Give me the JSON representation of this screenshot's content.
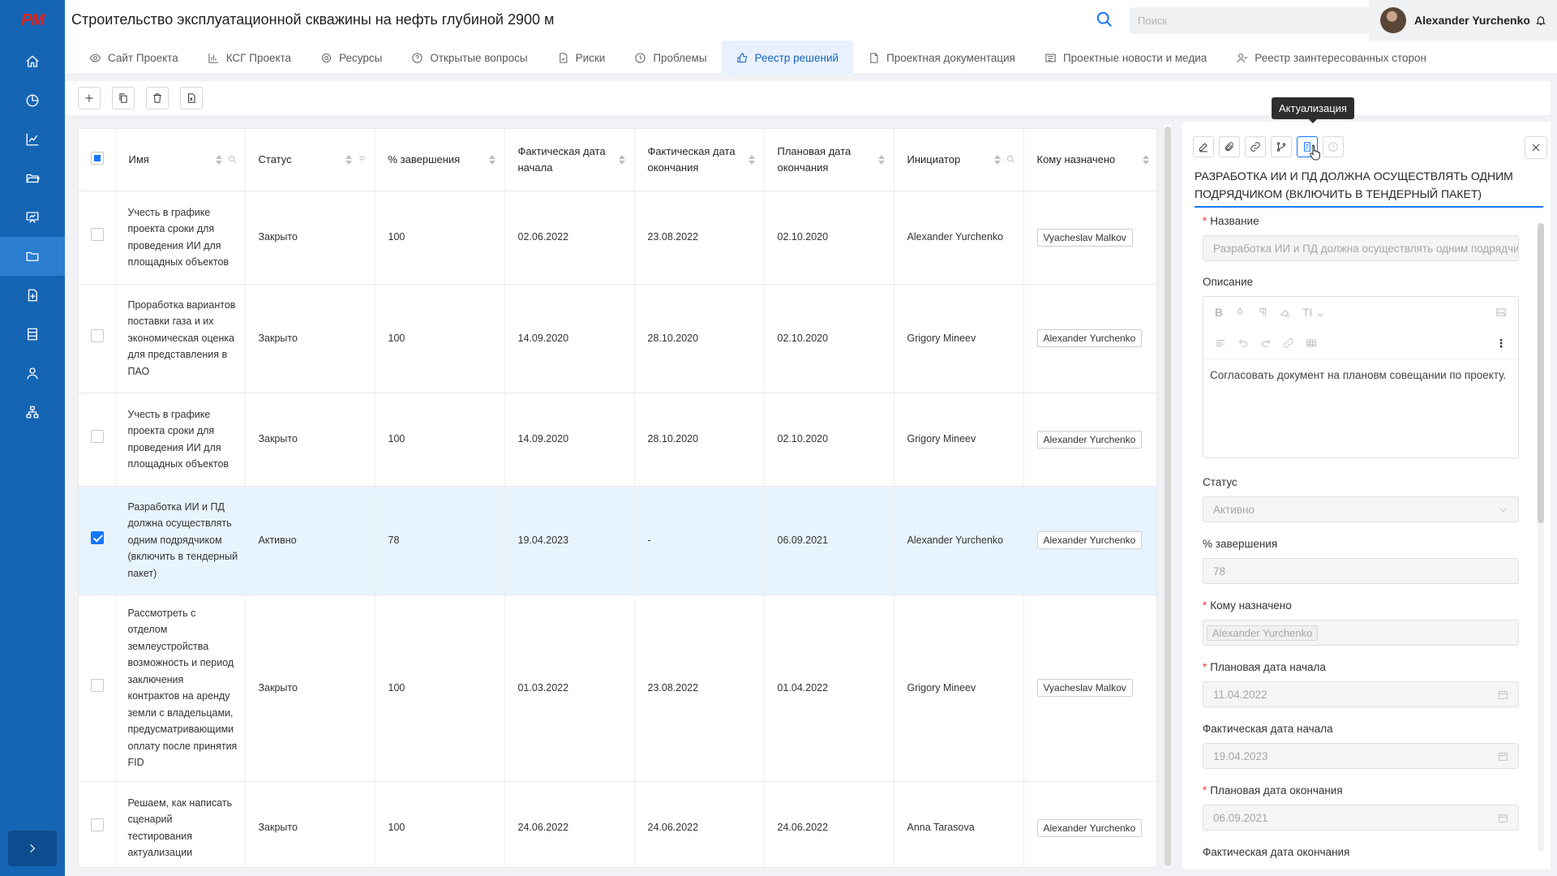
{
  "app": {
    "logo": "PM",
    "title": "Строительство эксплуатационной скважины на нефть глубиной 2900 м"
  },
  "header": {
    "search_placeholder": "Поиск",
    "user_name": "Alexander Yurchenko"
  },
  "sidebar": {
    "items": [
      {
        "icon": "home-icon"
      },
      {
        "icon": "pie-chart-icon"
      },
      {
        "icon": "line-chart-icon"
      },
      {
        "icon": "folder-open-icon"
      },
      {
        "icon": "presentation-icon"
      },
      {
        "icon": "folder-icon",
        "active": true
      },
      {
        "icon": "file-add-icon"
      },
      {
        "icon": "database-icon"
      },
      {
        "icon": "user-icon"
      },
      {
        "icon": "org-chart-icon"
      }
    ]
  },
  "tabs": [
    {
      "label": "Сайт Проекта",
      "icon": "eye-icon"
    },
    {
      "label": "КСГ Проекта",
      "icon": "bar-chart-icon"
    },
    {
      "label": "Ресурсы",
      "icon": "gear-icon"
    },
    {
      "label": "Открытые вопросы",
      "icon": "question-icon"
    },
    {
      "label": "Риски",
      "icon": "file-check-icon"
    },
    {
      "label": "Проблемы",
      "icon": "clock-icon"
    },
    {
      "label": "Реестр решений",
      "icon": "thumbs-up-icon",
      "active": true
    },
    {
      "label": "Проектная документация",
      "icon": "file-icon"
    },
    {
      "label": "Проектные новости и медиа",
      "icon": "news-icon"
    },
    {
      "label": "Реестр заинтересованных сторон",
      "icon": "users-icon"
    }
  ],
  "table": {
    "columns": [
      "Имя",
      "Статус",
      "% завершения",
      "Фактическая дата начала",
      "Фактическая дата окончания",
      "Плановая дата окончания",
      "Инициатор",
      "Кому назначено"
    ],
    "rows": [
      {
        "name": "Учесть в графике проекта сроки для проведения ИИ для площадных объектов",
        "status": "Закрыто",
        "pct": "100",
        "fact_start": "02.06.2022",
        "fact_end": "23.08.2022",
        "plan_end": "02.10.2020",
        "initiator": "Alexander Yurchenko",
        "assignee": "Vyacheslav Malkov"
      },
      {
        "name": "Проработка вариантов поставки газа и их экономическая оценка для представления в ПАО",
        "status": "Закрыто",
        "pct": "100",
        "fact_start": "14.09.2020",
        "fact_end": "28.10.2020",
        "plan_end": "02.10.2020",
        "initiator": "Grigory Mineev",
        "assignee": "Alexander Yurchenko"
      },
      {
        "name": "Учесть в графике проекта сроки для проведения ИИ для площадных объектов",
        "status": "Закрыто",
        "pct": "100",
        "fact_start": "14.09.2020",
        "fact_end": "28.10.2020",
        "plan_end": "02.10.2020",
        "initiator": "Grigory Mineev",
        "assignee": "Alexander Yurchenko"
      },
      {
        "name": "Разработка ИИ и ПД должна осуществлять одним подрядчиком (включить в тендерный пакет)",
        "status": "Активно",
        "pct": "78",
        "fact_start": "19.04.2023",
        "fact_end": "-",
        "plan_end": "06.09.2021",
        "initiator": "Alexander Yurchenko",
        "assignee": "Alexander Yurchenko",
        "selected": true
      },
      {
        "name": "Рассмотреть с отделом землеустройства возможность и период заключения контрактов на аренду земли с владельцами, предусматривающими оплату после принятия FID",
        "status": "Закрыто",
        "pct": "100",
        "fact_start": "01.03.2022",
        "fact_end": "23.08.2022",
        "plan_end": "01.04.2022",
        "initiator": "Grigory Mineev",
        "assignee": "Vyacheslav Malkov"
      },
      {
        "name": "Решаем, как написать сценарий тестирования актуализации",
        "status": "Закрыто",
        "pct": "100",
        "fact_start": "24.06.2022",
        "fact_end": "24.06.2022",
        "plan_end": "24.06.2022",
        "initiator": "Anna Tarasova",
        "assignee": "Alexander Yurchenko"
      }
    ]
  },
  "panel": {
    "tooltip": "Актуализация",
    "heading": "Разработка ИИ и ПД должна осуществлять одним подрядчиком (включить в тендерный пакет)",
    "fields": {
      "name_label": "Название",
      "name_value": "Разработка ИИ и ПД должна осуществлять одним подрядчиком (включить в тендерный пакет)",
      "desc_label": "Описание",
      "desc_value": "Согласовать документ на плановм совещании по проекту.",
      "status_label": "Статус",
      "status_value": "Активно",
      "pct_label": "% завершения",
      "pct_value": "78",
      "assignee_label": "Кому назначено",
      "assignee_value": "Alexander Yurchenko",
      "plan_start_label": "Плановая дата начала",
      "plan_start_value": "11.04.2022",
      "fact_start_label": "Фактическая дата начала",
      "fact_start_value": "19.04.2023",
      "plan_end_label": "Плановая дата окончания",
      "plan_end_value": "06.09.2021",
      "fact_end_label": "Фактическая дата окончания"
    }
  }
}
